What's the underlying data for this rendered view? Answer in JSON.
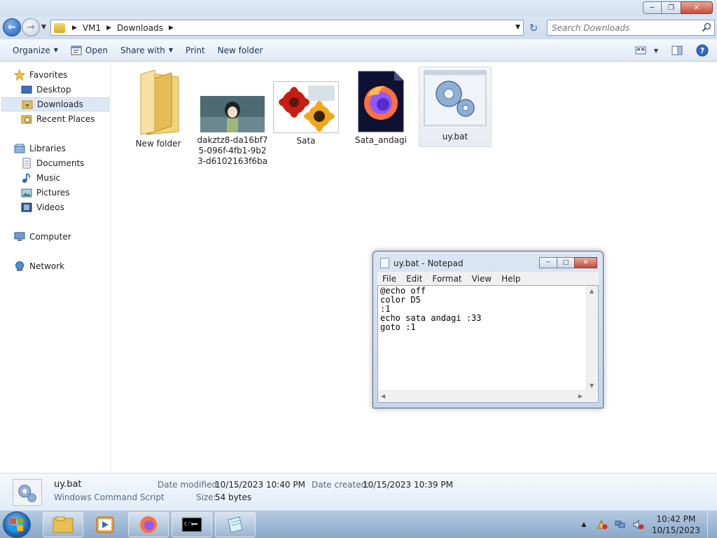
{
  "explorer": {
    "address": {
      "crumbs": [
        "VM1",
        "Downloads"
      ]
    },
    "search": {
      "placeholder": "Search Downloads"
    },
    "toolbar": {
      "organize": "Organize",
      "open": "Open",
      "share_with": "Share with",
      "print": "Print",
      "new_folder": "New folder"
    },
    "nav": {
      "favorites": "Favorites",
      "desktop": "Desktop",
      "downloads": "Downloads",
      "recent_places": "Recent Places",
      "libraries": "Libraries",
      "documents": "Documents",
      "music": "Music",
      "pictures": "Pictures",
      "videos": "Videos",
      "computer": "Computer",
      "network": "Network"
    },
    "files": [
      {
        "name": "New folder",
        "icon": "folder-icon"
      },
      {
        "name": "dakztz8-da16bf75-096f-4fb1-9b23-d6102163f6ba",
        "icon": "anime-image-thumbnail"
      },
      {
        "name": "Sata",
        "icon": "flower-image-thumbnail"
      },
      {
        "name": "Sata_andagi",
        "icon": "firefox-document-icon"
      },
      {
        "name": "uy.bat",
        "icon": "batch-gear-icon"
      }
    ],
    "details": {
      "name": "uy.bat",
      "type": "Windows Command Script",
      "modified_label": "Date modified:",
      "modified_value": "10/15/2023 10:40 PM",
      "size_label": "Size:",
      "size_value": "54 bytes",
      "created_label": "Date created:",
      "created_value": "10/15/2023 10:39 PM"
    }
  },
  "notepad": {
    "title": "uy.bat - Notepad",
    "menu": {
      "file": "File",
      "edit": "Edit",
      "format": "Format",
      "view": "View",
      "help": "Help"
    },
    "content": "@echo off\ncolor D5\n:1\necho sata andagi :33\ngoto :1"
  },
  "taskbar": {
    "clock_time": "10:42 PM",
    "clock_date": "10/15/2023"
  },
  "colors": {
    "selection": "#dde8f6",
    "accent": "#1f5fb8",
    "close": "#c84d3c"
  }
}
